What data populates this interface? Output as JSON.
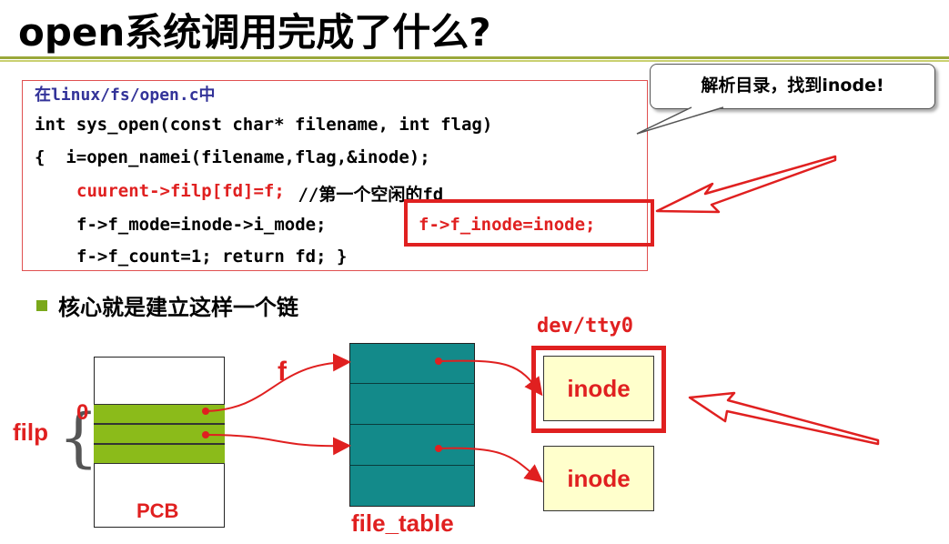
{
  "title": "open系统调用完成了什么?",
  "code": {
    "header": "在linux/fs/open.c中",
    "line1": "int sys_open(const char* filename, int flag)",
    "line2": "{  i=open_namei(filename,flag,&inode);",
    "line3_red": "cuurent->filp[fd]=f;",
    "line3_rest": " //第一个空闲的fd",
    "line4": "f->f_mode=inode->i_mode;",
    "line4_red": "f->f_inode=inode;",
    "line5": "f->f_count=1; return fd; }"
  },
  "callout": "解析目录，找到inode!",
  "bullet": "核心就是建立这样一个链",
  "diagram": {
    "tty_label": "dev/tty0",
    "f_label": "f",
    "filp_label": "filp",
    "zero_label": "0",
    "pcb_label": "PCB",
    "file_table_label": "file_table",
    "inode1": "inode",
    "inode2": "inode"
  },
  "colors": {
    "accent_red": "#e02020",
    "slot_green": "#8bbb1a",
    "file_table_teal": "#138a8a",
    "inode_fill": "#ffffcc"
  }
}
